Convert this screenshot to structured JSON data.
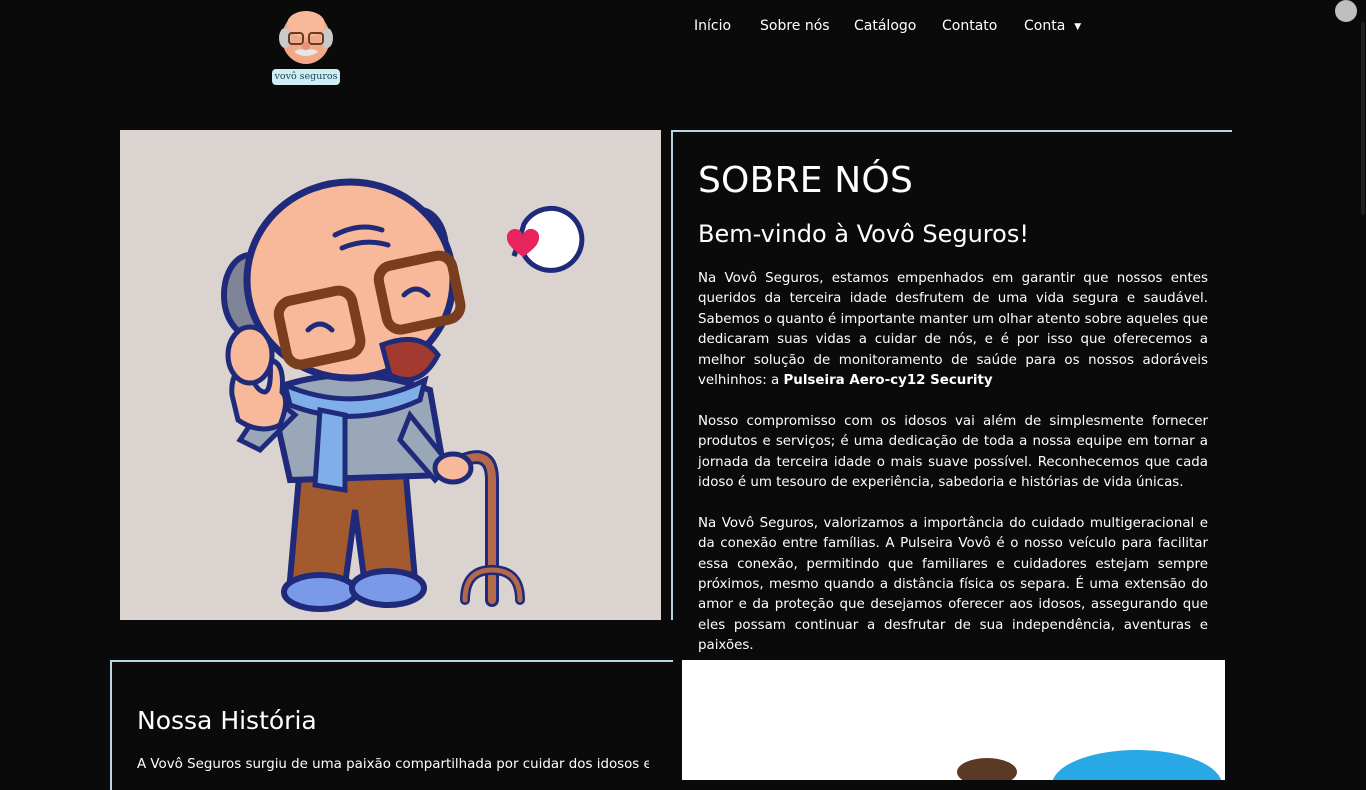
{
  "brand": {
    "logo_label": "vovô seguros"
  },
  "nav": {
    "items": [
      "Início",
      "Sobre nós",
      "Catálogo",
      "Contato"
    ],
    "account": "Conta",
    "caret": "▼"
  },
  "about": {
    "title": "SOBRE NÓS",
    "subtitle": "Bem-vindo à Vovô Seguros!",
    "p1": "Na Vovô Seguros, estamos empenhados em garantir que nossos entes queridos da terceira idade desfrutem de uma vida segura e saudável. Sabemos o quanto é importante manter um olhar atento sobre aqueles que dedicaram suas vidas a cuidar de nós, e é por isso que oferecemos a melhor solução de monitoramento de saúde para os nossos adoráveis velhinhos: a",
    "p1_bold": "Pulseira Aero-cy12 Security",
    "p2": "Nosso compromisso com os idosos vai além de simplesmente fornecer produtos e serviços; é uma dedicação de toda a nossa equipe em tornar a jornada da terceira idade o mais suave possível. Reconhecemos que cada idoso é um tesouro de experiência, sabedoria e histórias de vida únicas.",
    "p3": "Na Vovô Seguros, valorizamos a importância do cuidado multigeracional e da conexão entre famílias. A Pulseira Vovô é o nosso veículo para facilitar essa conexão, permitindo que familiares e cuidadores estejam sempre próximos, mesmo quando a distância física os separa. É uma extensão do amor e da proteção que desejamos oferecer aos idosos, assegurando que eles possam continuar a desfrutar de sua independência, aventuras e paixões."
  },
  "history": {
    "title": "Nossa História",
    "text": "A Vovô Seguros surgiu de uma paixão compartilhada por cuidar dos idosos em"
  },
  "colors": {
    "background": "#0a0a0b",
    "panel_border": "#b9d5df",
    "image_bg": "#dbd3cf",
    "heart": "#e8245f"
  }
}
